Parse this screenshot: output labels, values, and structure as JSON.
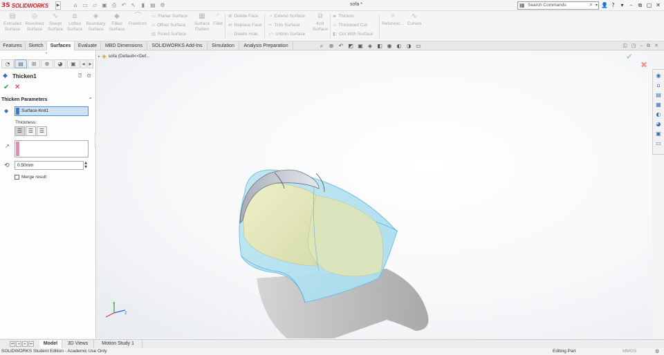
{
  "app": {
    "logo_mark": "3S",
    "logo_text": "SOLIDWORKS",
    "document_title": "sofa *",
    "search_placeholder": "Search Commands"
  },
  "ribbon": {
    "buttons": [
      {
        "label": "Extruded\nSurface",
        "icon": "extruded-surface-icon",
        "glyph": "▤"
      },
      {
        "label": "Revolved\nSurface",
        "icon": "revolved-surface-icon",
        "glyph": "◎"
      },
      {
        "label": "Swept\nSurface",
        "icon": "swept-surface-icon",
        "glyph": "∿"
      },
      {
        "label": "Lofted\nSurface",
        "icon": "lofted-surface-icon",
        "glyph": "⧈"
      },
      {
        "label": "Boundary\nSurface",
        "icon": "boundary-surface-icon",
        "glyph": "◈"
      },
      {
        "label": "Filled\nSurface",
        "icon": "filled-surface-icon",
        "glyph": "◆"
      },
      {
        "label": "Freeform",
        "icon": "freeform-icon",
        "glyph": "⌒"
      }
    ],
    "col1": [
      "Planar Surface",
      "Offset Surface",
      "Ruled Surface"
    ],
    "surface_flatten": "Surface\nFlatten",
    "fillet": "Fillet",
    "col2": [
      "Delete Face",
      "Replace Face",
      "Delete Hole"
    ],
    "col3": [
      "Extend Surface",
      "Trim Surface",
      "Untrim Surface"
    ],
    "knit_surface": "Knit\nSurface",
    "col4": [
      "Thicken",
      "Thickened Cut",
      "Cut With Surface"
    ],
    "reference": "Referenc...",
    "curves": "Curves"
  },
  "tabs": [
    "Features",
    "Sketch",
    "Surfaces",
    "Evaluate",
    "MBD Dimensions",
    "SOLIDWORKS Add-Ins",
    "Simulation",
    "Analysis Preparation"
  ],
  "active_tab": "Surfaces",
  "property_manager": {
    "title": "Thicken1",
    "section": "Thicken Parameters",
    "selection": "Surface-Knit1",
    "thickness_label": "Thickness:",
    "thickness_value": "0.50mm",
    "merge_label": "Merge result"
  },
  "tree": {
    "root": "sofa  (Default<<Def..."
  },
  "bottom_tabs": [
    "Model",
    "3D Views",
    "Motion Study 1"
  ],
  "status": {
    "left": "SOLIDWORKS Student Edition - Academic Use Only",
    "mode": "Editing Part",
    "units": "MMGS"
  },
  "colors": {
    "accent": "#3b7cd1",
    "brand_red": "#d31f26",
    "ok_green": "#2a9d3a",
    "direction_pink": "#e88ab8"
  }
}
